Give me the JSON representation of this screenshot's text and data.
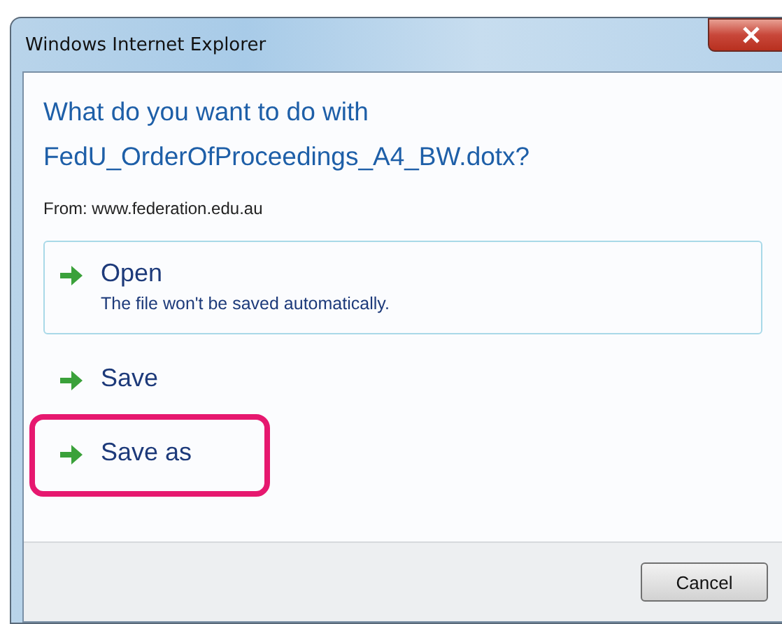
{
  "window": {
    "title": "Windows Internet Explorer"
  },
  "heading": [
    "What do you want to do with",
    "FedU_OrderOfProceedings_A4_BW.dotx?"
  ],
  "from": "From: www.federation.edu.au",
  "options": [
    {
      "label": "Open",
      "description": "The file won't be saved automatically.",
      "selected": true,
      "highlighted": false
    },
    {
      "label": "Save",
      "selected": false,
      "highlighted": false
    },
    {
      "label": "Save as",
      "selected": false,
      "highlighted": true
    }
  ],
  "buttons": [
    "Cancel"
  ]
}
